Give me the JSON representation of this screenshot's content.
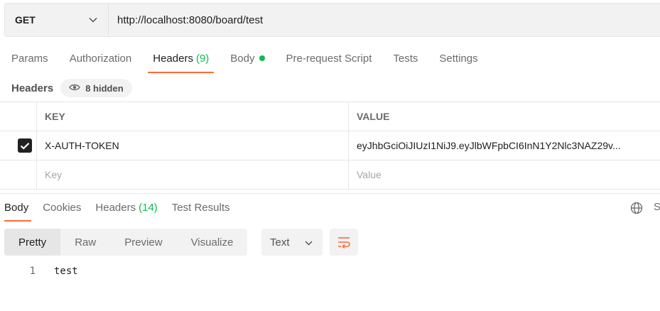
{
  "request": {
    "method": "GET",
    "url": "http://localhost:8080/board/test"
  },
  "request_tabs": [
    {
      "label": "Params"
    },
    {
      "label": "Authorization"
    },
    {
      "label": "Headers",
      "count": "(9)",
      "active": true
    },
    {
      "label": "Body",
      "has_dot": true
    },
    {
      "label": "Pre-request Script"
    },
    {
      "label": "Tests"
    },
    {
      "label": "Settings"
    }
  ],
  "headers_section": {
    "title": "Headers",
    "hidden_label": "8 hidden"
  },
  "headers_table": {
    "columns": {
      "key": "KEY",
      "value": "VALUE"
    },
    "rows": [
      {
        "checked": true,
        "key": "X-AUTH-TOKEN",
        "value": "eyJhbGciOiJIUzI1NiJ9.eyJlbWFpbCI6InN1Y2Nlc3NAZ29v..."
      }
    ],
    "placeholder": {
      "key": "Key",
      "value": "Value"
    }
  },
  "response_tabs": [
    {
      "label": "Body",
      "active": true
    },
    {
      "label": "Cookies"
    },
    {
      "label": "Headers",
      "count": "(14)"
    },
    {
      "label": "Test Results"
    }
  ],
  "response_right": {
    "save_label": "S"
  },
  "view_modes": [
    {
      "label": "Pretty",
      "active": true
    },
    {
      "label": "Raw"
    },
    {
      "label": "Preview"
    },
    {
      "label": "Visualize"
    }
  ],
  "format": {
    "selected": "Text"
  },
  "response_body": {
    "lines": [
      {
        "number": "1",
        "text": "test"
      }
    ]
  },
  "colors": {
    "accent": "#ff6c37",
    "success": "#0cbb52",
    "surface": "#f2f2f2"
  }
}
